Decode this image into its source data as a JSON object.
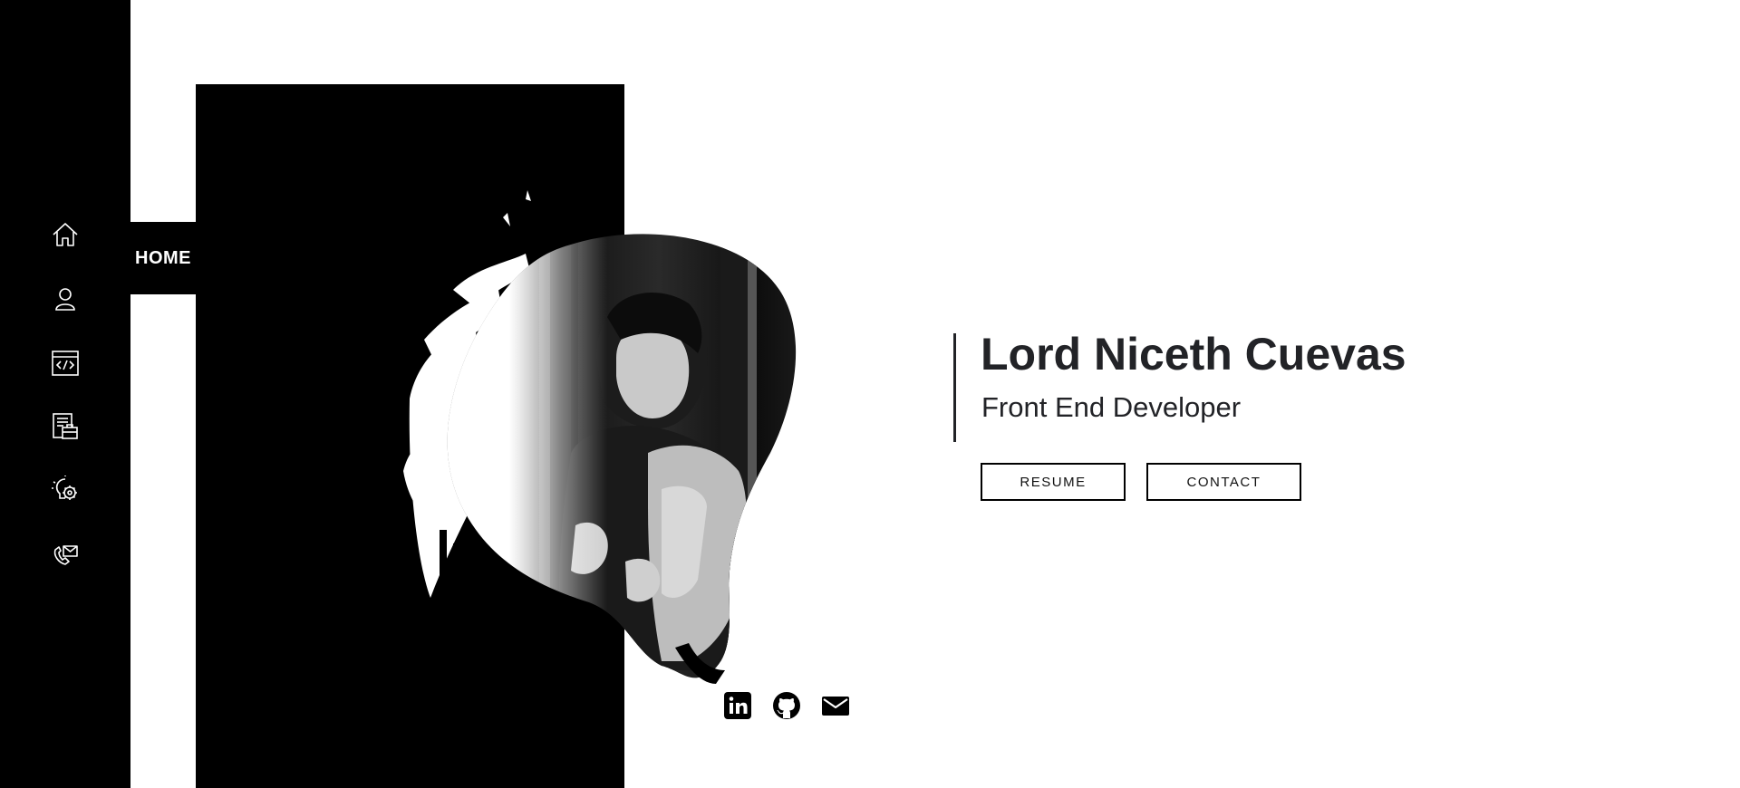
{
  "nav": {
    "active_label": "HOME",
    "items": [
      {
        "icon": "home-icon"
      },
      {
        "icon": "user-icon"
      },
      {
        "icon": "code-window-icon"
      },
      {
        "icon": "briefcase-document-icon"
      },
      {
        "icon": "gear-bulb-icon"
      },
      {
        "icon": "mail-phone-icon"
      }
    ]
  },
  "hero": {
    "name": "Lord Niceth Cuevas",
    "role": "Front End Developer",
    "resume_label": "RESUME",
    "contact_label": "CONTACT"
  },
  "socials": [
    {
      "icon": "linkedin-icon"
    },
    {
      "icon": "github-icon"
    },
    {
      "icon": "email-icon"
    }
  ],
  "colors": {
    "sidebar": "#000000",
    "text": "#222327",
    "background": "#ffffff"
  }
}
